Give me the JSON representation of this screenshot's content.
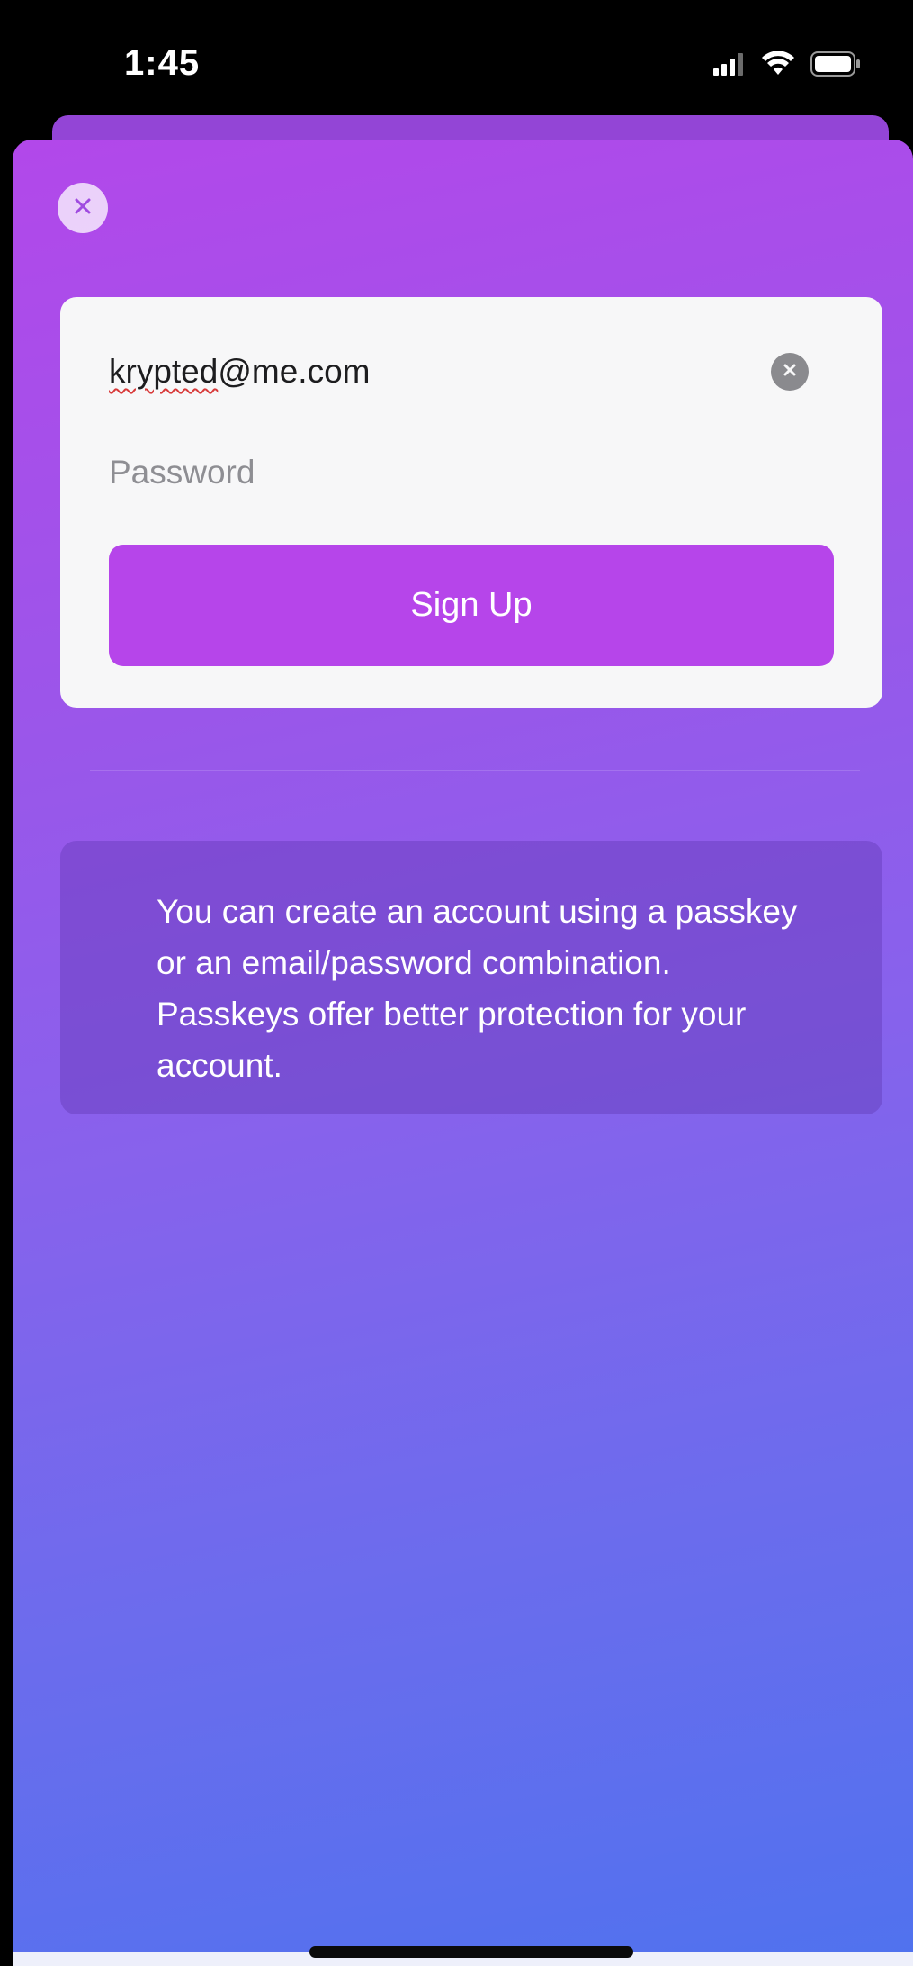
{
  "status_bar": {
    "time": "1:45",
    "icons": [
      "cellular-signal-icon",
      "wifi-icon",
      "battery-icon"
    ]
  },
  "sheet": {
    "close_icon": "close-icon",
    "form": {
      "email_value": "krypted@me.com",
      "email_misspelled_part": "krypted",
      "email_rest": "@me.com",
      "clear_icon": "clear-icon",
      "password_placeholder": "Password",
      "password_value": "",
      "signup_label": "Sign Up"
    },
    "info_text": "You can create an account using a passkey or an email/password combination. Passkeys offer better protection for your account."
  },
  "colors": {
    "accent": "#b645ea",
    "gradient_top": "#b248ea",
    "gradient_bottom": "#4f72ee",
    "card_bg": "#f7f7f8"
  }
}
